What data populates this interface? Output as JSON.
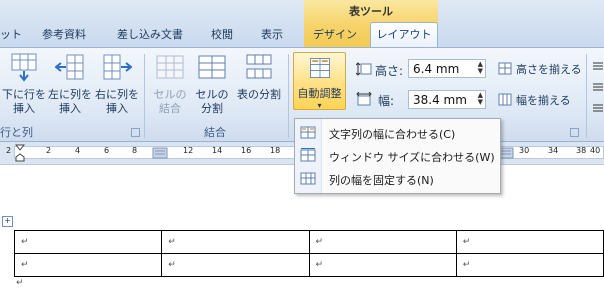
{
  "context_tab_group": {
    "title": "表ツール"
  },
  "tabs": [
    {
      "label": "ット"
    },
    {
      "label": "参考資料"
    },
    {
      "label": "差し込み文書"
    },
    {
      "label": "校閲"
    },
    {
      "label": "表示"
    },
    {
      "label": "デザイン"
    },
    {
      "label": "レイアウト"
    }
  ],
  "ribbon": {
    "rows_columns": {
      "label": "行と列",
      "insert_below": [
        "下に行を",
        "挿入"
      ],
      "insert_left": [
        "左に列を",
        "挿入"
      ],
      "insert_right": [
        "右に列を",
        "挿入"
      ]
    },
    "merge": {
      "label": "結合",
      "merge_cells": [
        "セルの",
        "結合"
      ],
      "split_cells": [
        "セルの",
        "分割"
      ],
      "split_table": [
        "表の分割"
      ]
    },
    "autofit": {
      "label": "自動調整",
      "arrow": "▾"
    },
    "cell_size": {
      "height_label": "高さ:",
      "height_value": "6.4 mm",
      "width_label": "幅:",
      "width_value": "38.4 mm",
      "distribute_rows": "高さを揃える",
      "distribute_columns": "幅を揃える"
    }
  },
  "ruler": {
    "numbers": [
      "2",
      "2",
      "4",
      "6",
      "8",
      "12",
      "14",
      "16",
      "18",
      "20",
      "22",
      "24",
      "26",
      "28",
      "30",
      "32",
      "34",
      "36",
      "38",
      "40"
    ]
  },
  "menu": {
    "items": [
      {
        "label": "文字列の幅に合わせる(C)"
      },
      {
        "label": "ウィンドウ サイズに合わせる(W)"
      },
      {
        "label": "列の幅を固定する(N)"
      }
    ]
  },
  "table_cell_mark": "↵",
  "colors": {
    "accent": "#15428b",
    "ribbon_bg": "#dde8f5",
    "context_tab": "#f6d36a"
  }
}
